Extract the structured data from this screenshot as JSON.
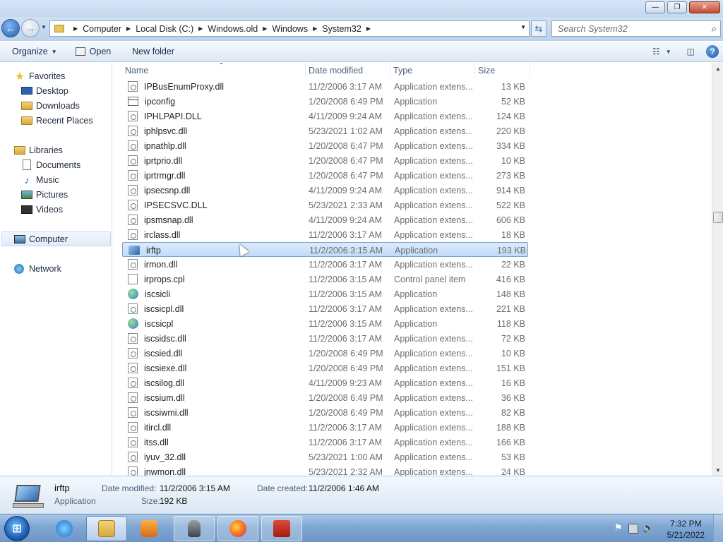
{
  "window": {
    "buttons": {
      "minimize": "—",
      "maximize": "❐",
      "close": "✕"
    }
  },
  "address": {
    "breadcrumbs": [
      "Computer",
      "Local Disk (C:)",
      "Windows.old",
      "Windows",
      "System32"
    ],
    "search_placeholder": "Search System32"
  },
  "toolbar": {
    "organize_label": "Organize",
    "open_label": "Open",
    "new_folder_label": "New folder"
  },
  "nav": {
    "favorites": {
      "label": "Favorites",
      "items": [
        "Desktop",
        "Downloads",
        "Recent Places"
      ]
    },
    "libraries": {
      "label": "Libraries",
      "items": [
        "Documents",
        "Music",
        "Pictures",
        "Videos"
      ]
    },
    "computer": "Computer",
    "network": "Network"
  },
  "columns": {
    "name": "Name",
    "date": "Date modified",
    "type": "Type",
    "size": "Size"
  },
  "files": [
    {
      "name": "IPBusEnumProxy.dll",
      "date": "11/2/2006 3:17 AM",
      "type": "Application extens...",
      "size": "13 KB",
      "icon": "dll-icon"
    },
    {
      "name": "ipconfig",
      "date": "1/20/2008 6:49 PM",
      "type": "Application",
      "size": "52 KB",
      "icon": "application-icon"
    },
    {
      "name": "IPHLPAPI.DLL",
      "date": "4/11/2009 9:24 AM",
      "type": "Application extens...",
      "size": "124 KB",
      "icon": "dll-icon"
    },
    {
      "name": "iphlpsvc.dll",
      "date": "5/23/2021 1:02 AM",
      "type": "Application extens...",
      "size": "220 KB",
      "icon": "dll-icon"
    },
    {
      "name": "ipnathlp.dll",
      "date": "1/20/2008 6:47 PM",
      "type": "Application extens...",
      "size": "334 KB",
      "icon": "dll-icon"
    },
    {
      "name": "iprtprio.dll",
      "date": "1/20/2008 6:47 PM",
      "type": "Application extens...",
      "size": "10 KB",
      "icon": "dll-icon"
    },
    {
      "name": "iprtrmgr.dll",
      "date": "1/20/2008 6:47 PM",
      "type": "Application extens...",
      "size": "273 KB",
      "icon": "dll-icon"
    },
    {
      "name": "ipsecsnp.dll",
      "date": "4/11/2009 9:24 AM",
      "type": "Application extens...",
      "size": "914 KB",
      "icon": "dll-icon"
    },
    {
      "name": "IPSECSVC.DLL",
      "date": "5/23/2021 2:33 AM",
      "type": "Application extens...",
      "size": "522 KB",
      "icon": "dll-icon"
    },
    {
      "name": "ipsmsnap.dll",
      "date": "4/11/2009 9:24 AM",
      "type": "Application extens...",
      "size": "606 KB",
      "icon": "dll-icon"
    },
    {
      "name": "irclass.dll",
      "date": "11/2/2006 3:17 AM",
      "type": "Application extens...",
      "size": "18 KB",
      "icon": "dll-icon"
    },
    {
      "name": "irftp",
      "date": "11/2/2006 3:15 AM",
      "type": "Application",
      "size": "193 KB",
      "icon": "infrared-icon",
      "selected": true
    },
    {
      "name": "irmon.dll",
      "date": "11/2/2006 3:17 AM",
      "type": "Application extens...",
      "size": "22 KB",
      "icon": "dll-icon"
    },
    {
      "name": "irprops.cpl",
      "date": "11/2/2006 3:15 AM",
      "type": "Control panel item",
      "size": "416 KB",
      "icon": "cpl-icon"
    },
    {
      "name": "iscsicli",
      "date": "11/2/2006 3:15 AM",
      "type": "Application",
      "size": "148 KB",
      "icon": "globe-icon"
    },
    {
      "name": "iscsicpl.dll",
      "date": "11/2/2006 3:17 AM",
      "type": "Application extens...",
      "size": "221 KB",
      "icon": "dll-icon"
    },
    {
      "name": "iscsicpl",
      "date": "11/2/2006 3:15 AM",
      "type": "Application",
      "size": "118 KB",
      "icon": "globe-icon"
    },
    {
      "name": "iscsidsc.dll",
      "date": "11/2/2006 3:17 AM",
      "type": "Application extens...",
      "size": "72 KB",
      "icon": "dll-icon"
    },
    {
      "name": "iscsied.dll",
      "date": "1/20/2008 6:49 PM",
      "type": "Application extens...",
      "size": "10 KB",
      "icon": "dll-icon"
    },
    {
      "name": "iscsiexe.dll",
      "date": "1/20/2008 6:49 PM",
      "type": "Application extens...",
      "size": "151 KB",
      "icon": "dll-icon"
    },
    {
      "name": "iscsilog.dll",
      "date": "4/11/2009 9:23 AM",
      "type": "Application extens...",
      "size": "16 KB",
      "icon": "dll-icon"
    },
    {
      "name": "iscsium.dll",
      "date": "1/20/2008 6:49 PM",
      "type": "Application extens...",
      "size": "36 KB",
      "icon": "dll-icon"
    },
    {
      "name": "iscsiwmi.dll",
      "date": "1/20/2008 6:49 PM",
      "type": "Application extens...",
      "size": "82 KB",
      "icon": "dll-icon"
    },
    {
      "name": "itircl.dll",
      "date": "11/2/2006 3:17 AM",
      "type": "Application extens...",
      "size": "188 KB",
      "icon": "dll-icon"
    },
    {
      "name": "itss.dll",
      "date": "11/2/2006 3:17 AM",
      "type": "Application extens...",
      "size": "166 KB",
      "icon": "dll-icon"
    },
    {
      "name": "iyuv_32.dll",
      "date": "5/23/2021 1:00 AM",
      "type": "Application extens...",
      "size": "53 KB",
      "icon": "dll-icon"
    },
    {
      "name": "jnwmon.dll",
      "date": "5/23/2021 2:32 AM",
      "type": "Application extens...",
      "size": "24 KB",
      "icon": "dll-icon"
    }
  ],
  "details": {
    "name": "irftp",
    "type": "Application",
    "date_modified_label": "Date modified:",
    "date_modified": "11/2/2006 3:15 AM",
    "date_created_label": "Date created:",
    "date_created": "11/2/2006 1:46 AM",
    "size_label": "Size:",
    "size": "192 KB"
  },
  "taskbar": {
    "start_label": "Start",
    "apps": [
      "internet-explorer-icon",
      "windows-explorer-icon",
      "media-player-icon",
      "chess-icon",
      "firefox-icon",
      "toolbox-icon"
    ],
    "time": "7:32 PM",
    "date": "5/21/2022"
  },
  "colors": {
    "accent": "#1f5fb4",
    "selection": "#c1dcfa",
    "selection_border": "#7da2ce"
  }
}
